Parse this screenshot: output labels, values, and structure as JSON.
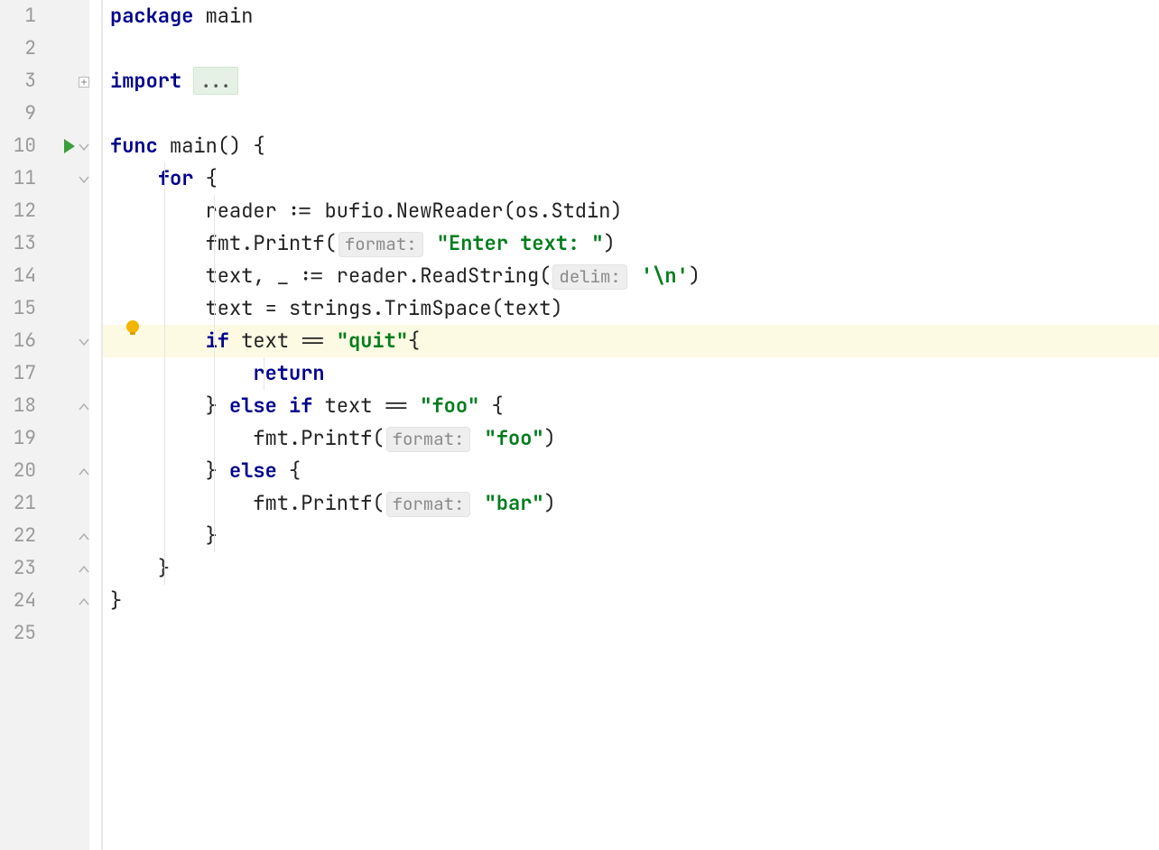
{
  "lineNumbers": [
    "1",
    "2",
    "3",
    "9",
    "10",
    "11",
    "12",
    "13",
    "14",
    "15",
    "16",
    "17",
    "18",
    "19",
    "20",
    "21",
    "22",
    "23",
    "24",
    "25"
  ],
  "highlightIndex": 10,
  "runIconIndex": 4,
  "bulbIndex": 10,
  "fold": {
    "plus": [
      2
    ],
    "openTop": [
      4,
      5
    ],
    "closeBottom": [
      12,
      14,
      16,
      17,
      18
    ],
    "openTopSmall": [
      10
    ]
  },
  "code": {
    "l0": {
      "kw_package": "package",
      "sp": " ",
      "main": "main"
    },
    "l1": {},
    "l2": {
      "kw_import": "import",
      "sp": " ",
      "ellipsis": "..."
    },
    "l3": {},
    "l4": {
      "kw_func": "func",
      "sp": " ",
      "main": "main",
      "parens": "()",
      "sp2": " ",
      "brace": "{"
    },
    "l5": {
      "indent": "    ",
      "kw_for": "for",
      "sp": " ",
      "brace": "{"
    },
    "l6": {
      "indent": "        ",
      "txt": "reader := bufio.NewReader(os.Stdin)"
    },
    "l7": {
      "indent": "        ",
      "pre": "fmt.Printf(",
      "hint": "format:",
      "sp": " ",
      "str": "\"Enter text: \"",
      "post": ")"
    },
    "l8": {
      "indent": "        ",
      "pre": "text, _ := reader.ReadString(",
      "hint": "delim:",
      "sp": " ",
      "str": "'\\n'",
      "post": ")"
    },
    "l9": {
      "indent": "        ",
      "txt": "text = strings.TrimSpace(text)"
    },
    "l10": {
      "indent": "        ",
      "kw_if": "if",
      "sp": " ",
      "expr": "text == ",
      "str": "\"quit\"",
      "brace": "{"
    },
    "l11": {
      "indent": "            ",
      "kw_return": "return"
    },
    "l12": {
      "indent": "        ",
      "close": "}",
      "sp": " ",
      "kw_else": "else",
      "sp2": " ",
      "kw_if": "if",
      "sp3": " ",
      "expr": "text == ",
      "str": "\"foo\"",
      "sp4": " ",
      "brace": "{"
    },
    "l13": {
      "indent": "            ",
      "pre": "fmt.Printf(",
      "hint": "format:",
      "sp": " ",
      "str": "\"foo\"",
      "post": ")"
    },
    "l14": {
      "indent": "        ",
      "close": "}",
      "sp": " ",
      "kw_else": "else",
      "sp2": " ",
      "brace": "{"
    },
    "l15": {
      "indent": "            ",
      "pre": "fmt.Printf(",
      "hint": "format:",
      "sp": " ",
      "str": "\"bar\"",
      "post": ")"
    },
    "l16": {
      "indent": "        ",
      "close": "}"
    },
    "l17": {
      "indent": "    ",
      "close": "}"
    },
    "l18": {
      "close": "}"
    },
    "l19": {}
  }
}
